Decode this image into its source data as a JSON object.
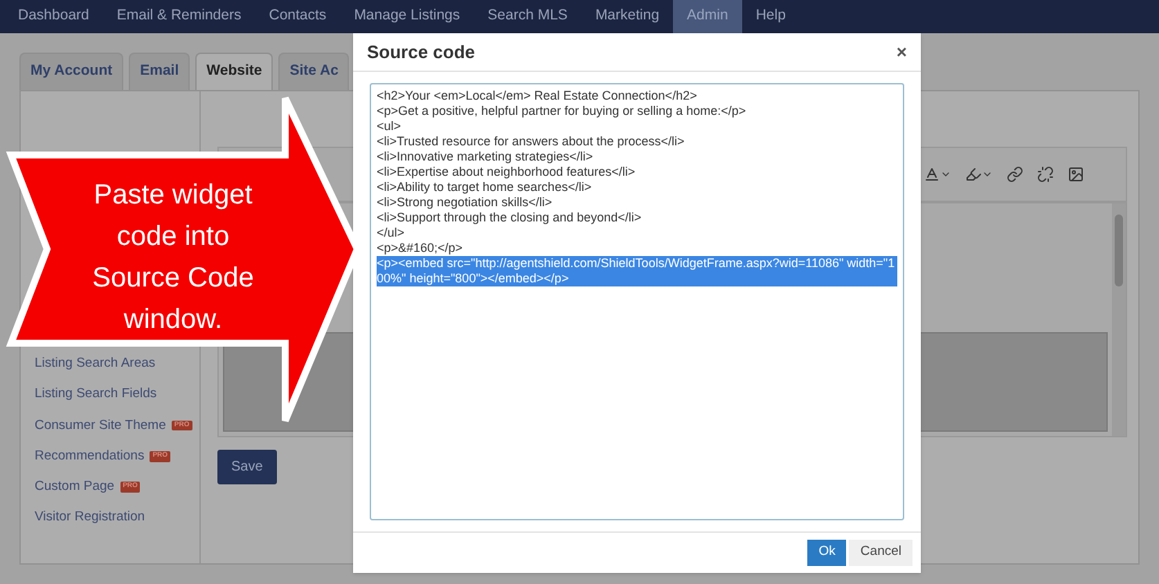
{
  "nav": [
    {
      "label": "Dashboard",
      "selected": false
    },
    {
      "label": "Email & Reminders",
      "selected": false
    },
    {
      "label": "Contacts",
      "selected": false
    },
    {
      "label": "Manage Listings",
      "selected": false
    },
    {
      "label": "Search MLS",
      "selected": false
    },
    {
      "label": "Marketing",
      "selected": false
    },
    {
      "label": "Admin",
      "selected": true
    },
    {
      "label": "Help",
      "selected": false
    }
  ],
  "tabs": [
    {
      "label": "My Account",
      "selected": false
    },
    {
      "label": "Email",
      "selected": false
    },
    {
      "label": "Website",
      "selected": true
    },
    {
      "label": "Site Ac",
      "selected": false
    }
  ],
  "sidebar": {
    "items": [
      {
        "label": "Listing Search Areas"
      },
      {
        "label": "Listing Search Fields"
      },
      {
        "label": "Consumer Site Theme",
        "badge": "PRO"
      },
      {
        "label": "Recommendations",
        "badge": "PRO"
      },
      {
        "label": "Custom Page",
        "badge": "PRO"
      },
      {
        "label": "Visitor Registration"
      }
    ]
  },
  "editor": {
    "save_button": "Save"
  },
  "dialog": {
    "title": "Source code",
    "close": "×",
    "code_lines": [
      {
        "text": "<h2>Your <em>Local</em> Real Estate Connection</h2>",
        "selected": false
      },
      {
        "text": "<p>Get a positive, helpful partner for buying or selling a home:</p>",
        "selected": false
      },
      {
        "text": "<ul>",
        "selected": false
      },
      {
        "text": "<li>Trusted resource for answers about the process</li>",
        "selected": false
      },
      {
        "text": "<li>Innovative marketing strategies</li>",
        "selected": false
      },
      {
        "text": "<li>Expertise about neighborhood features</li>",
        "selected": false
      },
      {
        "text": "<li>Ability to target home searches</li>",
        "selected": false
      },
      {
        "text": "<li>Strong negotiation skills</li>",
        "selected": false
      },
      {
        "text": "<li>Support through the closing and beyond</li>",
        "selected": false
      },
      {
        "text": "</ul>",
        "selected": false
      },
      {
        "text": "<p>&#160;</p>",
        "selected": false
      },
      {
        "text": "<p><embed src=\"http://agentshield.com/ShieldTools/WidgetFrame.aspx?wid=11086\" width=\"100%\" height=\"800\"></embed></p>",
        "selected": true
      }
    ],
    "buttons": [
      {
        "label": "Ok",
        "kind": "primary"
      },
      {
        "label": "Cancel",
        "kind": "secondary"
      }
    ]
  },
  "callout": {
    "lines": [
      "Paste widget",
      "code into",
      "Source Code",
      "window."
    ]
  }
}
